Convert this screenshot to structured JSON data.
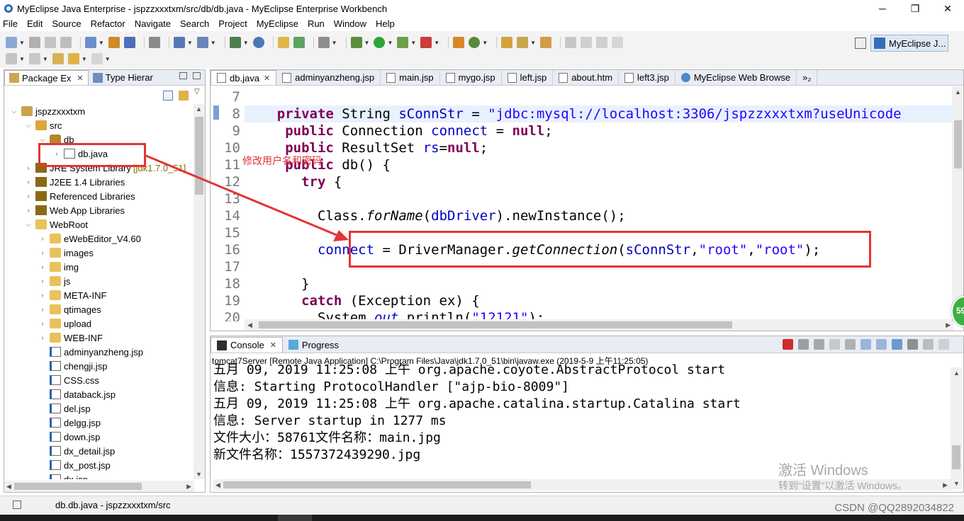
{
  "window": {
    "title": "MyEclipse Java Enterprise - jspzzxxxtxm/src/db/db.java - MyEclipse Enterprise Workbench",
    "minimize": "─",
    "maximize": "❐",
    "close": "✕"
  },
  "menu": [
    "File",
    "Edit",
    "Source",
    "Refactor",
    "Navigate",
    "Search",
    "Project",
    "MyEclipse",
    "Run",
    "Window",
    "Help"
  ],
  "perspective": {
    "label": "MyEclipse J..."
  },
  "package_explorer": {
    "tabs": [
      {
        "label": "Package Ex",
        "close": "✕"
      },
      {
        "label": "Type Hierar"
      }
    ],
    "tree": [
      {
        "label": "jspzzxxxtxm",
        "indent": 0,
        "arrow": "⌵",
        "icon": "project"
      },
      {
        "label": "src",
        "indent": 1,
        "arrow": "⌵",
        "icon": "srcfolder"
      },
      {
        "label": "db",
        "indent": 2,
        "arrow": "⌵",
        "icon": "pkg"
      },
      {
        "label": "db.java",
        "indent": 3,
        "arrow": "›",
        "icon": "java"
      },
      {
        "label": "JRE System Library",
        "deco": "[jdk1.7.0_51]",
        "indent": 1,
        "arrow": "›",
        "icon": "lib"
      },
      {
        "label": "J2EE 1.4 Libraries",
        "indent": 1,
        "arrow": "›",
        "icon": "lib"
      },
      {
        "label": "Referenced Libraries",
        "indent": 1,
        "arrow": "›",
        "icon": "lib"
      },
      {
        "label": "Web App Libraries",
        "indent": 1,
        "arrow": "›",
        "icon": "lib"
      },
      {
        "label": "WebRoot",
        "indent": 1,
        "arrow": "⌵",
        "icon": "folder"
      },
      {
        "label": "eWebEditor_V4.60",
        "indent": 2,
        "arrow": "›",
        "icon": "folder"
      },
      {
        "label": "images",
        "indent": 2,
        "arrow": "›",
        "icon": "folder"
      },
      {
        "label": "img",
        "indent": 2,
        "arrow": "›",
        "icon": "folder"
      },
      {
        "label": "js",
        "indent": 2,
        "arrow": "›",
        "icon": "folder"
      },
      {
        "label": "META-INF",
        "indent": 2,
        "arrow": "›",
        "icon": "folder"
      },
      {
        "label": "qtimages",
        "indent": 2,
        "arrow": "›",
        "icon": "folder"
      },
      {
        "label": "upload",
        "indent": 2,
        "arrow": "›",
        "icon": "folder"
      },
      {
        "label": "WEB-INF",
        "indent": 2,
        "arrow": "›",
        "icon": "folder"
      },
      {
        "label": "adminyanzheng.jsp",
        "indent": 2,
        "arrow": "",
        "icon": "jsp"
      },
      {
        "label": "chengji.jsp",
        "indent": 2,
        "arrow": "",
        "icon": "jsp"
      },
      {
        "label": "CSS.css",
        "indent": 2,
        "arrow": "",
        "icon": "jsp"
      },
      {
        "label": "databack.jsp",
        "indent": 2,
        "arrow": "",
        "icon": "jsp"
      },
      {
        "label": "del.jsp",
        "indent": 2,
        "arrow": "",
        "icon": "jsp"
      },
      {
        "label": "delgg.jsp",
        "indent": 2,
        "arrow": "",
        "icon": "jsp"
      },
      {
        "label": "down.jsp",
        "indent": 2,
        "arrow": "",
        "icon": "jsp"
      },
      {
        "label": "dx_detail.jsp",
        "indent": 2,
        "arrow": "",
        "icon": "jsp"
      },
      {
        "label": "dx_post.jsp",
        "indent": 2,
        "arrow": "",
        "icon": "jsp"
      },
      {
        "label": "dx.jsp",
        "indent": 2,
        "arrow": "",
        "icon": "jsp"
      }
    ]
  },
  "editor": {
    "tabs": [
      {
        "label": "db.java",
        "active": true,
        "close": "✕"
      },
      {
        "label": "adminyanzheng.jsp"
      },
      {
        "label": "main.jsp"
      },
      {
        "label": "mygo.jsp"
      },
      {
        "label": "left.jsp"
      },
      {
        "label": "about.htm"
      },
      {
        "label": "left3.jsp"
      },
      {
        "label": "MyEclipse Web Browse",
        "globe": true
      },
      {
        "label": "»₂"
      }
    ],
    "lines": [
      {
        "num": "7",
        "tokens": []
      },
      {
        "num": "8",
        "tokens": [
          [
            "",
            "    "
          ],
          [
            "kw",
            "private"
          ],
          [
            "",
            " String "
          ],
          [
            "fld",
            "sConnStr"
          ],
          [
            "",
            " = "
          ],
          [
            "str",
            "\"jdbc:mysql://localhost:3306/jspzzxxxtxm?useUnicode"
          ]
        ]
      },
      {
        "num": "9",
        "tokens": [
          [
            "",
            "     "
          ],
          [
            "kw",
            "public"
          ],
          [
            "",
            " Connection "
          ],
          [
            "fld",
            "connect"
          ],
          [
            "",
            " = "
          ],
          [
            "kw",
            "null"
          ],
          [
            "",
            ";"
          ]
        ]
      },
      {
        "num": "10",
        "tokens": [
          [
            "",
            "     "
          ],
          [
            "kw",
            "public"
          ],
          [
            "",
            " ResultSet "
          ],
          [
            "fld",
            "rs"
          ],
          [
            "",
            "="
          ],
          [
            "kw",
            "null"
          ],
          [
            "",
            ";"
          ]
        ]
      },
      {
        "num": "11",
        "tokens": [
          [
            "",
            "     "
          ],
          [
            "kw",
            "public"
          ],
          [
            "",
            " db() {"
          ]
        ]
      },
      {
        "num": "12",
        "tokens": [
          [
            "",
            "       "
          ],
          [
            "kw",
            "try"
          ],
          [
            "",
            " {"
          ]
        ]
      },
      {
        "num": "13",
        "tokens": []
      },
      {
        "num": "14",
        "tokens": [
          [
            "",
            "         Class."
          ],
          [
            "it",
            "forName"
          ],
          [
            "",
            "("
          ],
          [
            "fld",
            "dbDriver"
          ],
          [
            "",
            ").newInstance();"
          ]
        ]
      },
      {
        "num": "15",
        "tokens": []
      },
      {
        "num": "16",
        "tokens": [
          [
            "",
            "         "
          ],
          [
            "fld",
            "connect"
          ],
          [
            "",
            " = DriverManager."
          ],
          [
            "it",
            "getConnection"
          ],
          [
            "",
            "("
          ],
          [
            "fld",
            "sConnStr"
          ],
          [
            "",
            ","
          ],
          [
            "str",
            "\"root\""
          ],
          [
            "",
            ","
          ],
          [
            "str",
            "\"root\""
          ],
          [
            "",
            ");"
          ]
        ]
      },
      {
        "num": "17",
        "tokens": []
      },
      {
        "num": "18",
        "tokens": [
          [
            "",
            "       }"
          ]
        ]
      },
      {
        "num": "19",
        "tokens": [
          [
            "",
            "       "
          ],
          [
            "kw",
            "catch"
          ],
          [
            "",
            " (Exception ex) {"
          ]
        ]
      },
      {
        "num": "20",
        "tokens": [
          [
            "",
            "         System."
          ],
          [
            "fld it",
            "out"
          ],
          [
            "",
            ".println("
          ],
          [
            "str",
            "\"12121\""
          ],
          [
            "",
            ");"
          ]
        ]
      }
    ]
  },
  "annotation": {
    "text": "修改用户名和密码"
  },
  "console": {
    "tabs": [
      {
        "label": "Console",
        "close": "✕"
      },
      {
        "label": "Progress"
      }
    ],
    "process": "tomcat7Server [Remote Java Application] C:\\Program Files\\Java\\jdk1.7.0_51\\bin\\javaw.exe (2019-5-9 上午11:25:05)",
    "lines": [
      "五月 09, 2019 11:25:08 上午 org.apache.coyote.AbstractProtocol start",
      "信息: Starting ProtocolHandler [\"ajp-bio-8009\"]",
      "五月 09, 2019 11:25:08 上午 org.apache.catalina.startup.Catalina start",
      "信息: Server startup in 1277 ms",
      "文件大小：58761文件名称：main.jpg",
      "新文件名称：1557372439290.jpg"
    ]
  },
  "statusbar": {
    "text": "db.db.java - jspzzxxxtxm/src"
  },
  "watermark": {
    "line1": "激活 Windows",
    "line2": "转到“设置”以激活 Windows。"
  },
  "credit": "CSDN @QQ2892034822",
  "badge": "59",
  "colors": {
    "annotation": "#e53434",
    "keyword": "#7f0055",
    "field": "#0000c0",
    "string": "#2a00ff"
  }
}
